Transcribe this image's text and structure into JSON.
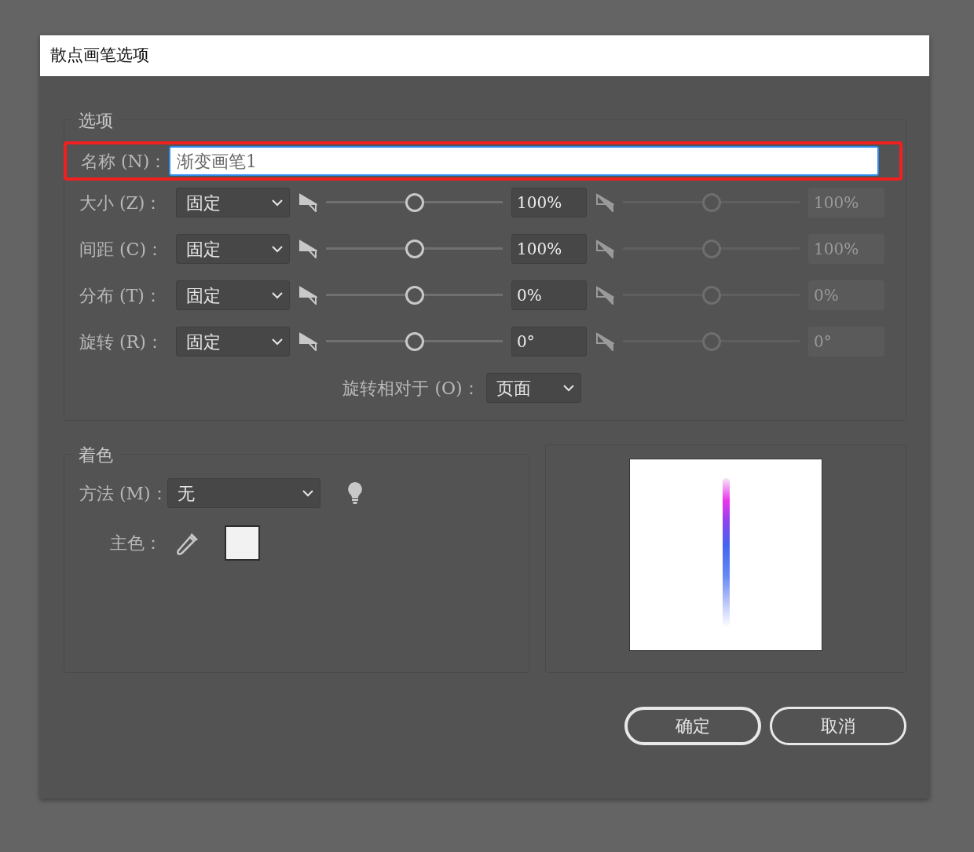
{
  "window": {
    "title": "散点画笔选项"
  },
  "options": {
    "legend": "选项",
    "name": {
      "label": "名称 (N)：",
      "value": "渐变画笔1",
      "focused": true,
      "highlighted": true
    },
    "rows": [
      {
        "label": "大小 (Z)：",
        "mode": "固定",
        "level": 0.5,
        "value": "100%",
        "max": {
          "level": 0.5,
          "value": "100%",
          "disabled": true
        }
      },
      {
        "label": "间距 (C)：",
        "mode": "固定",
        "level": 0.5,
        "value": "100%",
        "max": {
          "level": 0.5,
          "value": "100%",
          "disabled": true
        }
      },
      {
        "label": "分布 (T)：",
        "mode": "固定",
        "level": 0.5,
        "value": "0%",
        "max": {
          "level": 0.5,
          "value": "0%",
          "disabled": true
        }
      },
      {
        "label": "旋转 (R)：",
        "mode": "固定",
        "level": 0.5,
        "value": "0°",
        "max": {
          "level": 0.5,
          "value": "0°",
          "disabled": true
        }
      }
    ],
    "rotation_relative": {
      "label": "旋转相对于 (O)：",
      "value": "页面"
    }
  },
  "colorization": {
    "legend": "着色",
    "method": {
      "label": "方法 (M)：",
      "value": "无"
    },
    "key_color": {
      "label": "主色：",
      "color": "#f2f2f2"
    }
  },
  "buttons": [
    {
      "label": "确定",
      "default": true
    },
    {
      "label": "取消",
      "default": false
    }
  ]
}
